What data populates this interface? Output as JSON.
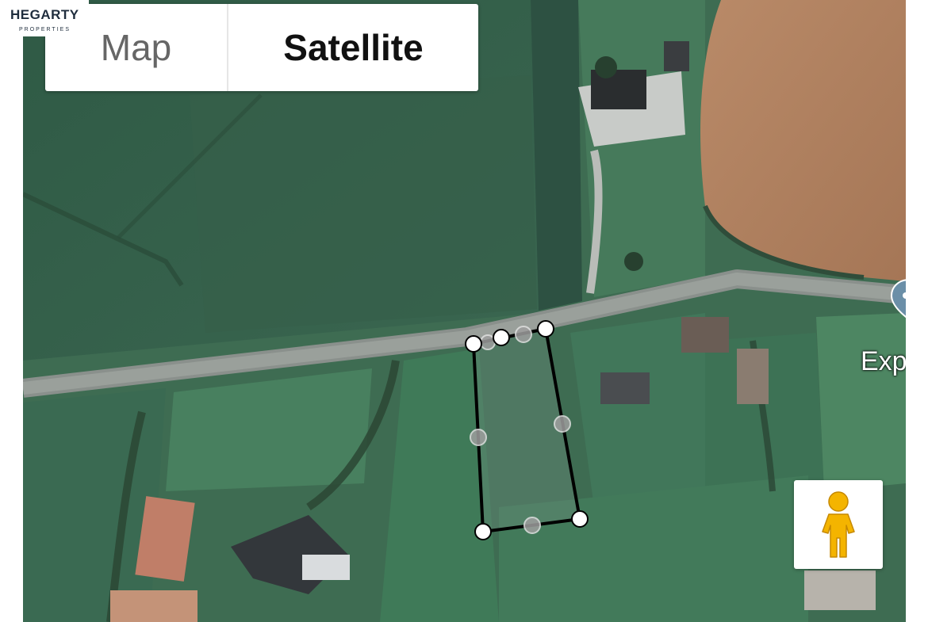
{
  "logo": {
    "name": "HEGARTY",
    "subtitle": "PROPERTIES"
  },
  "map_type_control": {
    "map_label": "Map",
    "satellite_label": "Satellite",
    "selected": "Satellite"
  },
  "place_label": "Exp",
  "icons": {
    "pegman": "pegman-icon",
    "place_pin": "place-pin-icon"
  },
  "colors": {
    "boundary_line": "#000000",
    "vertex_handle": "#ffffff",
    "midpoint_handle": "#9e9e9e",
    "pegman": "#f4b400",
    "logo_accent": "#e2632b"
  }
}
